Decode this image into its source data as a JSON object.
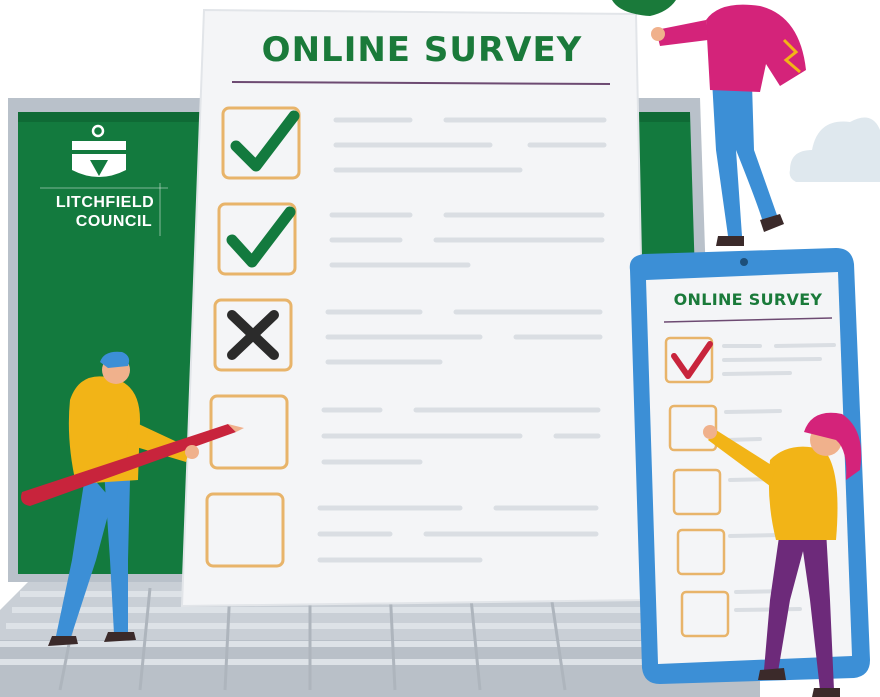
{
  "survey": {
    "title": "ONLINE SURVEY",
    "checkboxes": [
      "checked",
      "checked",
      "crossed",
      "empty",
      "empty"
    ]
  },
  "phone": {
    "title": "ONLINE SURVEY",
    "checkboxes": [
      "checked",
      "empty",
      "empty",
      "empty",
      "empty"
    ]
  },
  "logo": {
    "line1": "LITCHFIELD",
    "line2": "COUNCIL"
  },
  "colors": {
    "brand_green": "#1a7a3a",
    "screen_green": "#137a3e",
    "box_orange": "#e8b46a",
    "laptop_gray": "#c8ced4",
    "phone_blue": "#3c8fd6",
    "check_red": "#c8243c",
    "hoodie_yellow": "#f2b417",
    "pink": "#d4237a"
  }
}
